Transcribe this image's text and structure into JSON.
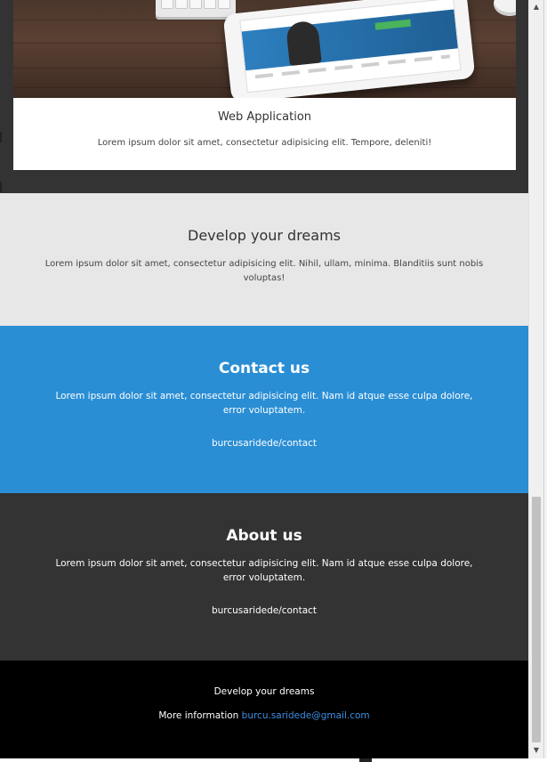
{
  "portfolio": {
    "image_alt": "tablet-on-desk-photo",
    "title": "Web Application",
    "text": "Lorem ipsum dolor sit amet, consectetur adipisicing elit. Tempore, deleniti!"
  },
  "dreams": {
    "title": "Develop your dreams",
    "text": "Lorem ipsum dolor sit amet, consectetur adipisicing elit. Nihil, ullam, minima. Blanditiis sunt nobis voluptas!"
  },
  "contact": {
    "title": "Contact us",
    "text": "Lorem ipsum dolor sit amet, consectetur adipisicing elit. Nam id atque esse culpa dolore, error voluptatem.",
    "link": "burcusaridede/contact"
  },
  "about": {
    "title": "About us",
    "text": "Lorem ipsum dolor sit amet, consectetur adipisicing elit. Nam id atque esse culpa dolore, error voluptatem.",
    "link": "burcusaridede/contact"
  },
  "footer": {
    "tagline": "Develop your dreams",
    "info_label": "More information",
    "email": "burcu.saridede@gmail.com"
  },
  "scrollbar": {
    "up_icon": "scroll-up-arrow",
    "down_icon": "scroll-down-arrow"
  },
  "colors": {
    "dark": "#333333",
    "light_gray": "#e7e7e7",
    "blue": "#2a8ed4",
    "black": "#000000",
    "link_blue": "#3a8fe0"
  }
}
